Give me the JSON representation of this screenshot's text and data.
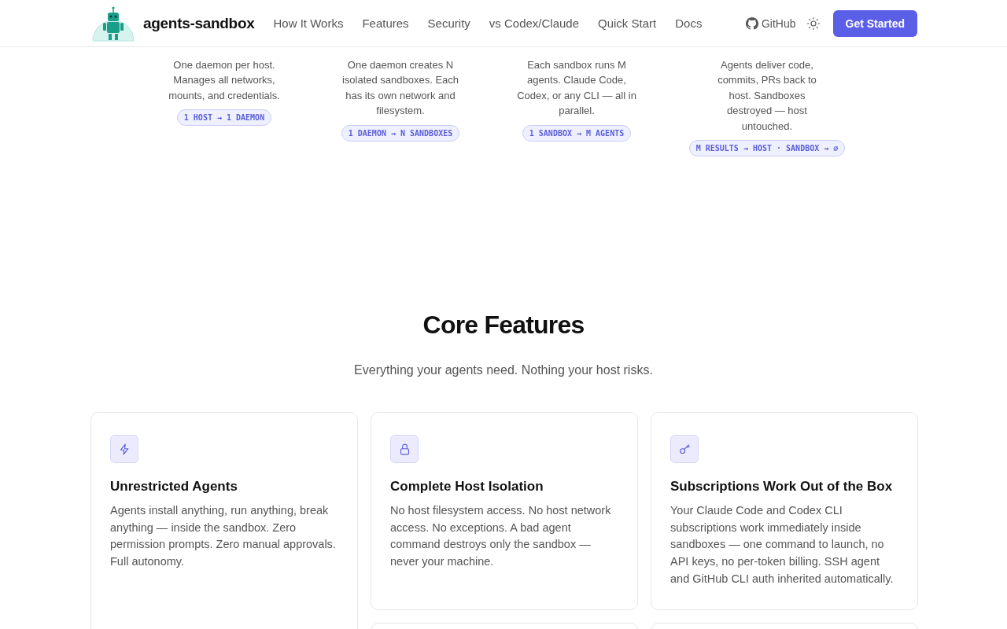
{
  "header": {
    "brand": "agents-sandbox",
    "nav": [
      "How It Works",
      "Features",
      "Security",
      "vs Codex/Claude",
      "Quick Start",
      "Docs"
    ],
    "github": "GitHub",
    "cta": "Get Started"
  },
  "steps": [
    {
      "text": "One daemon per host. Manages all networks, mounts, and credentials.",
      "tag": "1 HOST → 1 DAEMON"
    },
    {
      "text": "One daemon creates N isolated sandboxes. Each has its own network and filesystem.",
      "tag": "1 DAEMON → N SANDBOXES"
    },
    {
      "text": "Each sandbox runs M agents. Claude Code, Codex, or any CLI — all in parallel.",
      "tag": "1 SANDBOX → M AGENTS"
    },
    {
      "text": "Agents deliver code, commits, PRs back to host. Sandboxes destroyed — host untouched.",
      "tag": "M RESULTS → HOST · SANDBOX → ∅"
    }
  ],
  "features": {
    "title": "Core Features",
    "subtitle": "Everything your agents need. Nothing your host risks.",
    "cards": [
      {
        "kind": "bolt",
        "title": "Unrestricted Agents",
        "text": "Agents install anything, run anything, break anything — inside the sandbox. Zero permission prompts. Zero manual approvals. Full autonomy."
      },
      {
        "kind": "lock",
        "title": "Complete Host Isolation",
        "text": "No host filesystem access. No host network access. No exceptions. A bad agent command destroys only the sandbox — never your machine."
      },
      {
        "kind": "key",
        "title": "Subscriptions Work Out of the Box",
        "text": "Your Claude Code and Codex CLI subscriptions work immediately inside sandboxes — one command to launch, no API keys, no per-token billing. SSH agent and GitHub CLI auth inherited automatically."
      }
    ]
  }
}
